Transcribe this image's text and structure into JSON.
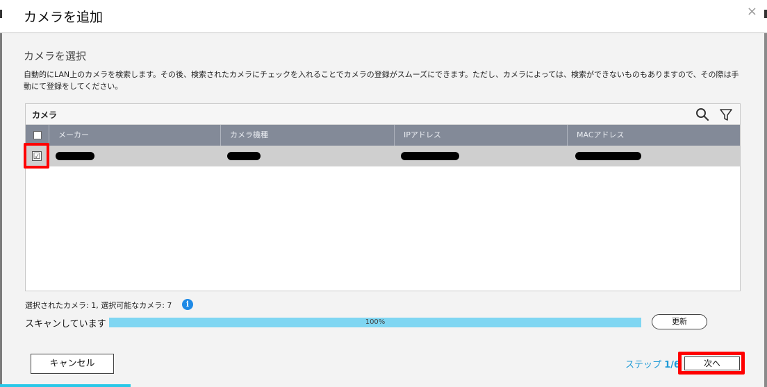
{
  "dialog": {
    "title": "カメラを追加",
    "close_symbol": "×"
  },
  "section": {
    "title": "カメラを選択",
    "description": "自動的にLAN上のカメラを検索します。その後、検索されたカメラにチェックを入れることでカメラの登録がスムーズにできます。ただし、カメラによっては、検索ができないものもありますので、その際は手動にて登録をしてください。"
  },
  "table": {
    "caption": "カメラ",
    "toolbar_icons": [
      "search-icon",
      "filter-icon"
    ],
    "columns": [
      "メーカー",
      "カメラ機種",
      "IPアドレス",
      "MACアドレス"
    ],
    "rows": [
      {
        "checked": true,
        "check_mark": "☑",
        "manufacturer": "",
        "model": "",
        "ip": "",
        "mac": "",
        "redacted": true
      }
    ]
  },
  "status": {
    "selected_info": "選択されたカメラ: 1, 選択可能なカメラ: 7",
    "info_symbol": "i",
    "scan_label": "スキャンしています",
    "progress_percent": 100,
    "progress_text": "100%",
    "refresh_label": "更新"
  },
  "footer": {
    "cancel_label": "キャンセル",
    "step_prefix": "ステップ ",
    "step_value": "1/6",
    "next_label": "次へ"
  },
  "colors": {
    "header_bg": "#838a98",
    "selected_row_bg": "#cfcfcf",
    "progress_fill": "#7fd6f2",
    "accent": "#1e9ad6",
    "highlight": "#ff0000"
  }
}
